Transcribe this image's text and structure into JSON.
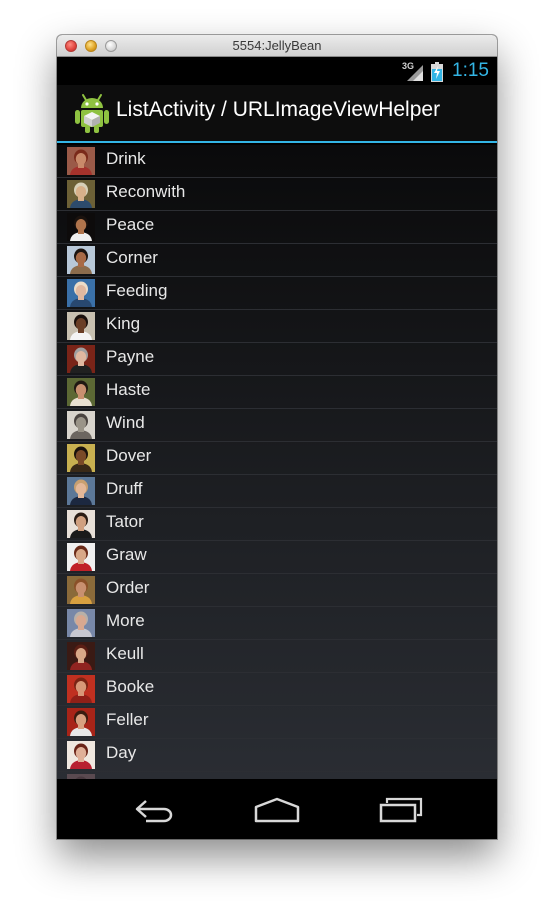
{
  "window": {
    "title": "5554:JellyBean"
  },
  "status_bar": {
    "network": "3G",
    "time": "1:15",
    "clock_color": "#33b5e5"
  },
  "action_bar": {
    "title": "ListActivity / URLImageViewHelper",
    "app_icon": "android-robot-icon",
    "accent_color": "#33b5e5"
  },
  "list": {
    "items": [
      {
        "label": "Drink",
        "avatar": "person-avatar",
        "skin": "#c98a6a",
        "hair": "#7a2a1a",
        "bg": "#9a5a48",
        "shirt": "#a4322c"
      },
      {
        "label": "Reconwith",
        "avatar": "person-avatar",
        "skin": "#d8b089",
        "hair": "#d7d0b8",
        "bg": "#6c6036",
        "shirt": "#2d4b6c"
      },
      {
        "label": "Peace",
        "avatar": "person-avatar",
        "skin": "#b0744c",
        "hair": "#1a120e",
        "bg": "#0d0b0b",
        "shirt": "#f0f0f0"
      },
      {
        "label": "Corner",
        "avatar": "person-avatar",
        "skin": "#a86a46",
        "hair": "#1c1410",
        "bg": "#b8c8d8",
        "shirt": "#8c6c4c"
      },
      {
        "label": "Feeding",
        "avatar": "person-avatar",
        "skin": "#e0b8a0",
        "hair": "#ecdcc8",
        "bg": "#3a70a8",
        "shirt": "#284870"
      },
      {
        "label": "King",
        "avatar": "person-avatar",
        "skin": "#6a3e26",
        "hair": "#1a100c",
        "bg": "#c8c0b0",
        "shirt": "#f4f4f4"
      },
      {
        "label": "Payne",
        "avatar": "person-avatar",
        "skin": "#e0b8a0",
        "hair": "#a0a0a0",
        "bg": "#7a2418",
        "shirt": "#202020"
      },
      {
        "label": "Haste",
        "avatar": "person-avatar",
        "skin": "#c89070",
        "hair": "#201812",
        "bg": "#5c6834",
        "shirt": "#e8e0d0"
      },
      {
        "label": "Wind",
        "avatar": "person-avatar",
        "skin": "#9a9488",
        "hair": "#4a4440",
        "bg": "#d8d4cc",
        "shirt": "#6c6660"
      },
      {
        "label": "Dover",
        "avatar": "person-avatar",
        "skin": "#7a4a28",
        "hair": "#1a120c",
        "bg": "#c8b050",
        "shirt": "#3a2a18"
      },
      {
        "label": "Druff",
        "avatar": "person-avatar",
        "skin": "#e4b898",
        "hair": "#c8a070",
        "bg": "#5c7898",
        "shirt": "#1c2840"
      },
      {
        "label": "Tator",
        "avatar": "person-avatar",
        "skin": "#d0a080",
        "hair": "#2a1c14",
        "bg": "#e8e0d8",
        "shirt": "#1a1a1a"
      },
      {
        "label": "Graw",
        "avatar": "person-avatar",
        "skin": "#d8a888",
        "hair": "#6a2a18",
        "bg": "#f0f0f0",
        "shirt": "#c02028"
      },
      {
        "label": "Order",
        "avatar": "person-avatar",
        "skin": "#c89070",
        "hair": "#8a5028",
        "bg": "#8a6a3a",
        "shirt": "#d8a040"
      },
      {
        "label": "More",
        "avatar": "person-avatar",
        "skin": "#d8a890",
        "hair": "#b8b0a8",
        "bg": "#7888a8",
        "shirt": "#c8c8d0"
      },
      {
        "label": "Keull",
        "avatar": "person-avatar",
        "skin": "#d8a888",
        "hair": "#5a1e14",
        "bg": "#3a1a14",
        "shirt": "#902420"
      },
      {
        "label": "Booke",
        "avatar": "person-avatar",
        "skin": "#d89878",
        "hair": "#7a2414",
        "bg": "#c03020",
        "shirt": "#902018"
      },
      {
        "label": "Feller",
        "avatar": "person-avatar",
        "skin": "#d8a080",
        "hair": "#3a1c10",
        "bg": "#a82418",
        "shirt": "#e8e8e8"
      },
      {
        "label": "Day",
        "avatar": "person-avatar",
        "skin": "#e0b098",
        "hair": "#6a2418",
        "bg": "#f0e8e0",
        "shirt": "#b82030"
      },
      {
        "label": "",
        "avatar": "person-avatar",
        "skin": "#6a5a60",
        "hair": "#4a3a40",
        "bg": "#5a4a50",
        "shirt": "#4a3a40"
      }
    ]
  },
  "nav_bar": {
    "back": "back-icon",
    "home": "home-icon",
    "recents": "recent-apps-icon"
  }
}
